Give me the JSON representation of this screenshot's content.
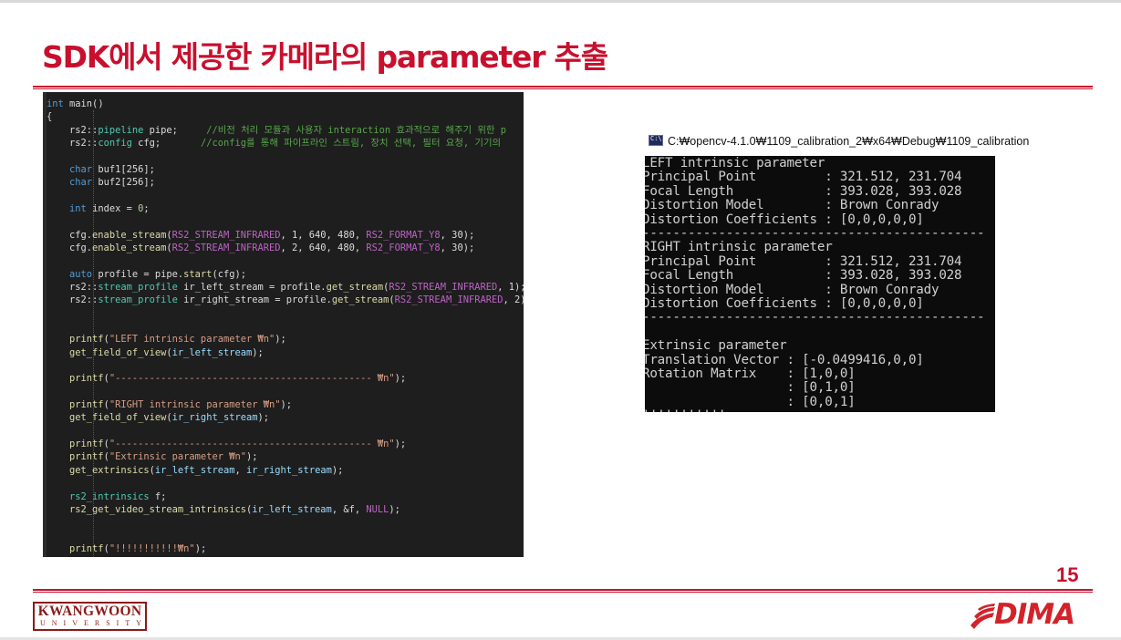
{
  "slide": {
    "title": "SDK에서 제공한 카메라의 parameter 추출",
    "page_number": "15"
  },
  "code_lines": [
    [
      {
        "t": "int",
        "c": "kw"
      },
      {
        "t": " main()",
        "c": ""
      }
    ],
    [
      {
        "t": "{",
        "c": ""
      }
    ],
    [
      {
        "t": "    rs2::",
        "c": ""
      },
      {
        "t": "pipeline",
        "c": "ty"
      },
      {
        "t": " pipe;     ",
        "c": ""
      },
      {
        "t": "//비전 처리 모듈과 사용자 interaction 효과적으로 해주기 위한 p",
        "c": "cm"
      }
    ],
    [
      {
        "t": "    rs2::",
        "c": ""
      },
      {
        "t": "config",
        "c": "ty"
      },
      {
        "t": " cfg;       ",
        "c": ""
      },
      {
        "t": "//config를 통해 파이프라인 스트림, 장치 선택, 필터 요청, 기기의",
        "c": "cm"
      }
    ],
    [],
    [
      {
        "t": "    ",
        "c": ""
      },
      {
        "t": "char",
        "c": "kw"
      },
      {
        "t": " buf1[256];",
        "c": ""
      }
    ],
    [
      {
        "t": "    ",
        "c": ""
      },
      {
        "t": "char",
        "c": "kw"
      },
      {
        "t": " buf2[256];",
        "c": ""
      }
    ],
    [],
    [
      {
        "t": "    ",
        "c": ""
      },
      {
        "t": "int",
        "c": "kw"
      },
      {
        "t": " index = ",
        "c": ""
      },
      {
        "t": "0",
        "c": "nu"
      },
      {
        "t": ";",
        "c": ""
      }
    ],
    [],
    [
      {
        "t": "    cfg.",
        "c": ""
      },
      {
        "t": "enable_stream",
        "c": "fn"
      },
      {
        "t": "(",
        "c": ""
      },
      {
        "t": "RS2_STREAM_INFRARED",
        "c": "mc"
      },
      {
        "t": ", 1, 640, 480, ",
        "c": ""
      },
      {
        "t": "RS2_FORMAT_Y8",
        "c": "mc"
      },
      {
        "t": ", 30);",
        "c": ""
      }
    ],
    [
      {
        "t": "    cfg.",
        "c": ""
      },
      {
        "t": "enable_stream",
        "c": "fn"
      },
      {
        "t": "(",
        "c": ""
      },
      {
        "t": "RS2_STREAM_INFRARED",
        "c": "mc"
      },
      {
        "t": ", 2, 640, 480, ",
        "c": ""
      },
      {
        "t": "RS2_FORMAT_Y8",
        "c": "mc"
      },
      {
        "t": ", 30);",
        "c": ""
      }
    ],
    [],
    [
      {
        "t": "    ",
        "c": ""
      },
      {
        "t": "auto",
        "c": "kw"
      },
      {
        "t": " profile = pipe.",
        "c": ""
      },
      {
        "t": "start",
        "c": "fn"
      },
      {
        "t": "(cfg);",
        "c": ""
      }
    ],
    [
      {
        "t": "    rs2::",
        "c": ""
      },
      {
        "t": "stream_profile",
        "c": "ty"
      },
      {
        "t": " ir_left_stream = profile.",
        "c": ""
      },
      {
        "t": "get_stream",
        "c": "fn"
      },
      {
        "t": "(",
        "c": ""
      },
      {
        "t": "RS2_STREAM_INFRARED",
        "c": "mc"
      },
      {
        "t": ", 1);",
        "c": ""
      }
    ],
    [
      {
        "t": "    rs2::",
        "c": ""
      },
      {
        "t": "stream_profile",
        "c": "ty"
      },
      {
        "t": " ir_right_stream = profile.",
        "c": ""
      },
      {
        "t": "get_stream",
        "c": "fn"
      },
      {
        "t": "(",
        "c": ""
      },
      {
        "t": "RS2_STREAM_INFRARED",
        "c": "mc"
      },
      {
        "t": ", 2);",
        "c": ""
      }
    ],
    [],
    [],
    [
      {
        "t": "    ",
        "c": ""
      },
      {
        "t": "printf",
        "c": "fn"
      },
      {
        "t": "(",
        "c": ""
      },
      {
        "t": "\"LEFT intrinsic parameter ₩n\"",
        "c": "st"
      },
      {
        "t": ");",
        "c": ""
      }
    ],
    [
      {
        "t": "    ",
        "c": ""
      },
      {
        "t": "get_field_of_view",
        "c": "fn"
      },
      {
        "t": "(",
        "c": ""
      },
      {
        "t": "ir_left_stream",
        "c": "vr"
      },
      {
        "t": ");",
        "c": ""
      }
    ],
    [],
    [
      {
        "t": "    ",
        "c": ""
      },
      {
        "t": "printf",
        "c": "fn"
      },
      {
        "t": "(",
        "c": ""
      },
      {
        "t": "\"--------------------------------------------- ₩n\"",
        "c": "st"
      },
      {
        "t": ");",
        "c": ""
      }
    ],
    [],
    [
      {
        "t": "    ",
        "c": ""
      },
      {
        "t": "printf",
        "c": "fn"
      },
      {
        "t": "(",
        "c": ""
      },
      {
        "t": "\"RIGHT intrinsic parameter ₩n\"",
        "c": "st"
      },
      {
        "t": ");",
        "c": ""
      }
    ],
    [
      {
        "t": "    ",
        "c": ""
      },
      {
        "t": "get_field_of_view",
        "c": "fn"
      },
      {
        "t": "(",
        "c": ""
      },
      {
        "t": "ir_right_stream",
        "c": "vr"
      },
      {
        "t": ");",
        "c": ""
      }
    ],
    [],
    [
      {
        "t": "    ",
        "c": ""
      },
      {
        "t": "printf",
        "c": "fn"
      },
      {
        "t": "(",
        "c": ""
      },
      {
        "t": "\"--------------------------------------------- ₩n\"",
        "c": "st"
      },
      {
        "t": ");",
        "c": ""
      }
    ],
    [
      {
        "t": "    ",
        "c": ""
      },
      {
        "t": "printf",
        "c": "fn"
      },
      {
        "t": "(",
        "c": ""
      },
      {
        "t": "\"Extrinsic parameter ₩n\"",
        "c": "st"
      },
      {
        "t": ");",
        "c": ""
      }
    ],
    [
      {
        "t": "    ",
        "c": ""
      },
      {
        "t": "get_extrinsics",
        "c": "fn"
      },
      {
        "t": "(",
        "c": ""
      },
      {
        "t": "ir_left_stream",
        "c": "vr"
      },
      {
        "t": ", ",
        "c": ""
      },
      {
        "t": "ir_right_stream",
        "c": "vr"
      },
      {
        "t": ");",
        "c": ""
      }
    ],
    [],
    [
      {
        "t": "    ",
        "c": ""
      },
      {
        "t": "rs2_intrinsics",
        "c": "ty"
      },
      {
        "t": " f;",
        "c": ""
      }
    ],
    [
      {
        "t": "    ",
        "c": ""
      },
      {
        "t": "rs2_get_video_stream_intrinsics",
        "c": "fn"
      },
      {
        "t": "(",
        "c": ""
      },
      {
        "t": "ir_left_stream",
        "c": "vr"
      },
      {
        "t": ", &f, ",
        "c": ""
      },
      {
        "t": "NULL",
        "c": "mc"
      },
      {
        "t": ");",
        "c": ""
      }
    ],
    [],
    [],
    [
      {
        "t": "    ",
        "c": ""
      },
      {
        "t": "printf",
        "c": "fn"
      },
      {
        "t": "(",
        "c": ""
      },
      {
        "t": "\"!!!!!!!!!!!₩n\"",
        "c": "st"
      },
      {
        "t": ");",
        "c": ""
      }
    ]
  ],
  "console": {
    "title": "C:₩opencv-4.1.0₩1109_calibration_2₩x64₩Debug₩1109_calibration",
    "lines": [
      "LEFT intrinsic parameter",
      "Principal Point         : 321.512, 231.704",
      "Focal Length            : 393.028, 393.028",
      "Distortion Model        : Brown Conrady",
      "Distortion Coefficients : [0,0,0,0,0]",
      "---------------------------------------------",
      "RIGHT intrinsic parameter",
      "Principal Point         : 321.512, 231.704",
      "Focal Length            : 393.028, 393.028",
      "Distortion Model        : Brown Conrady",
      "Distortion Coefficients : [0,0,0,0,0]",
      "---------------------------------------------",
      "",
      "Extrinsic parameter",
      "Translation Vector : [-0.0499416,0,0]",
      "Rotation Matrix    : [1,0,0]",
      "                   : [0,1,0]",
      "                   : [0,0,1]",
      "!!!!!!!!!!!"
    ]
  },
  "logos": {
    "left_name": "KWANGWOON",
    "left_sub": "UNIVERSITY",
    "right_word": "DIMA"
  }
}
